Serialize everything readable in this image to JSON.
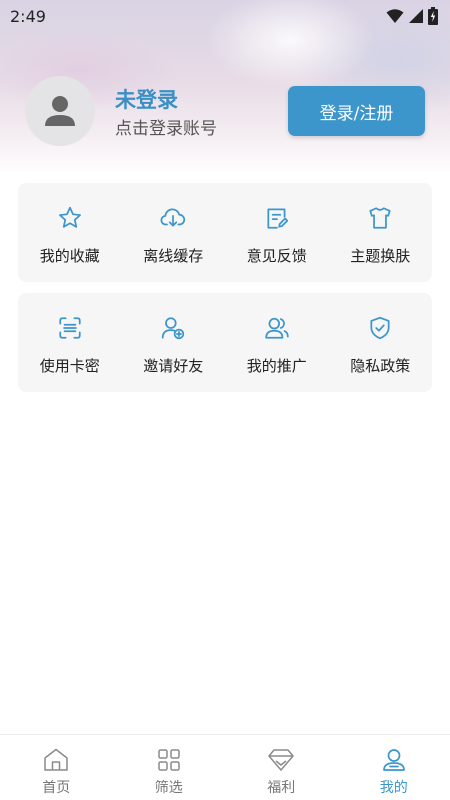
{
  "status_bar": {
    "time": "2:49"
  },
  "profile": {
    "name": "未登录",
    "subtitle": "点击登录账号",
    "login_button": "登录/注册"
  },
  "grid_row1": [
    {
      "label": "我的收藏",
      "icon": "star-icon"
    },
    {
      "label": "离线缓存",
      "icon": "cloud-download-icon"
    },
    {
      "label": "意见反馈",
      "icon": "feedback-edit-icon"
    },
    {
      "label": "主题换肤",
      "icon": "tshirt-icon"
    }
  ],
  "grid_row2": [
    {
      "label": "使用卡密",
      "icon": "scan-code-icon"
    },
    {
      "label": "邀请好友",
      "icon": "add-user-icon"
    },
    {
      "label": "我的推广",
      "icon": "users-icon"
    },
    {
      "label": "隐私政策",
      "icon": "shield-check-icon"
    }
  ],
  "bottom_nav": [
    {
      "label": "首页",
      "icon": "home-icon"
    },
    {
      "label": "筛选",
      "icon": "grid-icon"
    },
    {
      "label": "福利",
      "icon": "diamond-icon"
    },
    {
      "label": "我的",
      "icon": "user-icon",
      "active": true
    }
  ],
  "colors": {
    "accent": "#3c96cb",
    "name_text": "#3a8fc7",
    "card_bg": "#f6f6f7"
  }
}
